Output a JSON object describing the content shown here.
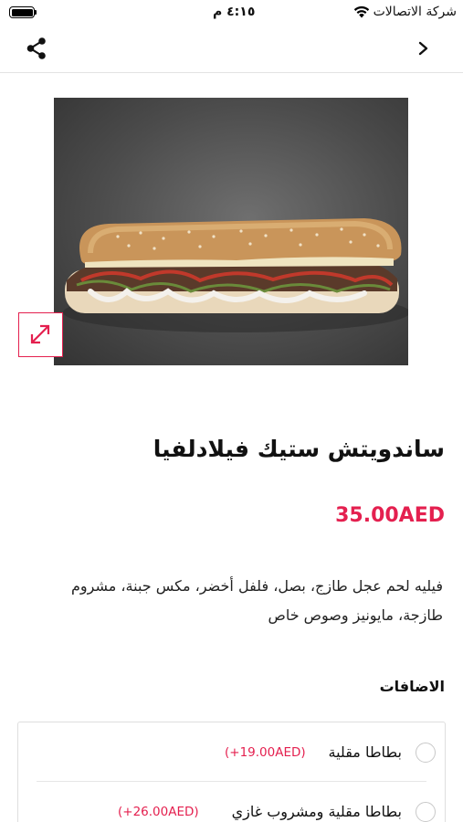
{
  "status_bar": {
    "carrier": "شركة الاتصالات",
    "time": "٤:١٥ م"
  },
  "nav": {
    "share_icon": "share-icon",
    "back_icon": "chevron-right-icon"
  },
  "product": {
    "image_alt": "sandwich-photo",
    "title": "ساندويتش ستيك فيلادلفيا",
    "price": "35.00AED",
    "description": "فيليه لحم عجل طازج، بصل، فلفل أخضر، مكس جبنة، مشروم طازجة، مايونيز وصوص خاص"
  },
  "addons": {
    "title": "الاضافات",
    "items": [
      {
        "label": "بطاطا مقلية",
        "price": "(+19.00AED)"
      },
      {
        "label": "بطاطا مقلية ومشروب غازي",
        "price": "(+26.00AED)"
      }
    ]
  },
  "colors": {
    "accent": "#e4204f"
  }
}
